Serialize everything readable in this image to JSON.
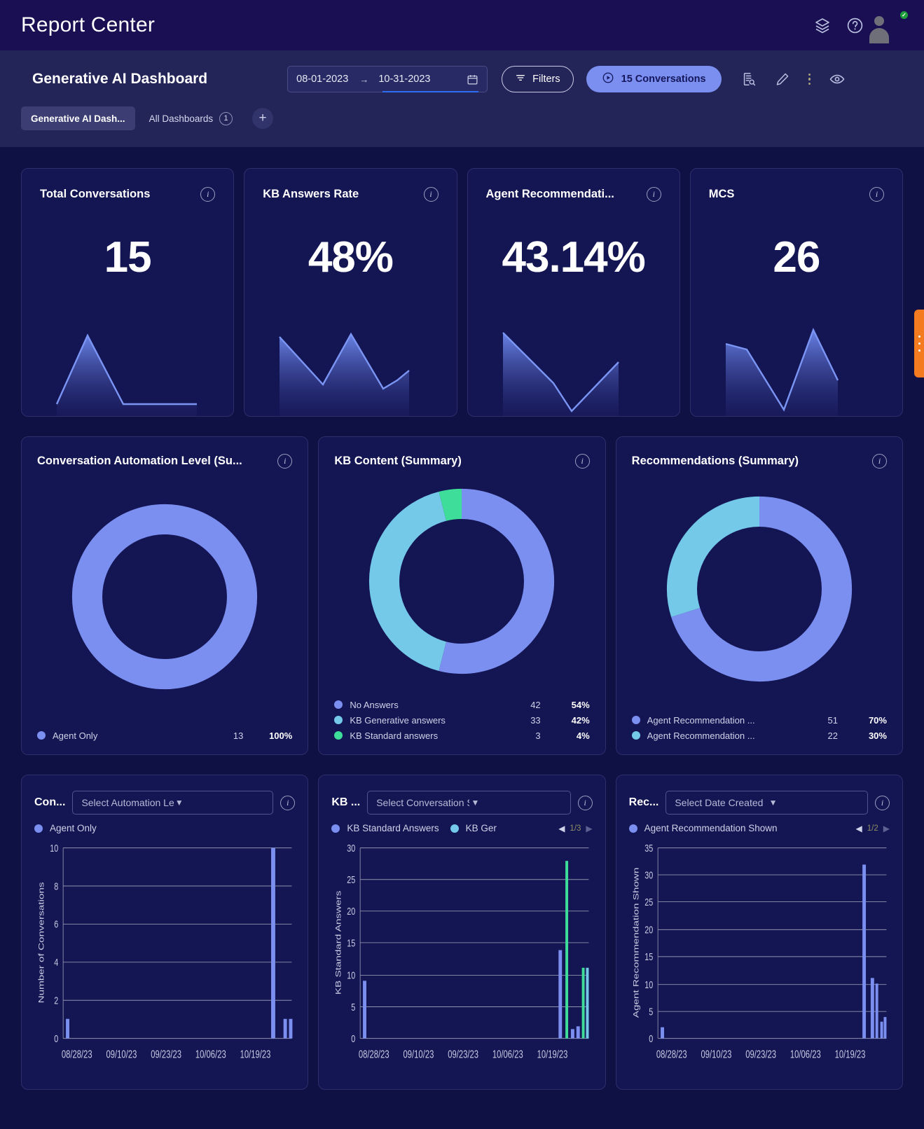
{
  "topbar": {
    "title": "Report Center",
    "icons": [
      "layers-icon",
      "help-icon",
      "avatar"
    ]
  },
  "dashboard_header": {
    "title": "Generative AI Dashboard",
    "date_from": "08-01-2023",
    "date_to": "10-31-2023",
    "range_arrow": "→",
    "filters_label": "Filters",
    "conversations_label": "15 Conversations",
    "accent_color": "#7b8ff0"
  },
  "tabs": [
    {
      "label": "Generative AI Dash...",
      "active": true,
      "count": ""
    },
    {
      "label": "All Dashboards",
      "active": false,
      "count": "1"
    }
  ],
  "tab_add_label": "+",
  "kpis": [
    {
      "title": "Total Conversations",
      "value": "15",
      "spark": "0,118 44,20 95,118 200,118 262,118"
    },
    {
      "title": "KB Answers Rate",
      "value": "48%",
      "spark": "0,24 65,92 105,21 160,98 185,82 200,68"
    },
    {
      "title": "Agent Recommendati...",
      "value": "43.14%",
      "spark": "0,18 70,84 125,122 200,62"
    },
    {
      "title": "MCS",
      "value": "26",
      "spark": "0,34 50,40 105,122 150,15 200,78"
    }
  ],
  "donuts": [
    {
      "title": "Conversation Automation Level (Su...",
      "chart_data": {
        "type": "pie",
        "title": "Conversation Automation Level (Summary)",
        "legend_position": "bottom",
        "labels": [
          "Agent Only"
        ],
        "values": [
          13
        ],
        "percents": [
          "100%"
        ],
        "colors": [
          "#7b8ff0"
        ]
      },
      "legend": [
        {
          "label": "Agent Only",
          "count": "13",
          "pct": "100%",
          "color": "#7b8ff0"
        }
      ]
    },
    {
      "title": "KB Content (Summary)",
      "chart_data": {
        "type": "pie",
        "title": "KB Content (Summary)",
        "legend_position": "bottom",
        "labels": [
          "No Answers",
          "KB Generative answers",
          "KB Standard answers"
        ],
        "values": [
          42,
          33,
          3
        ],
        "percents": [
          "54%",
          "42%",
          "4%"
        ],
        "colors": [
          "#7b8ff0",
          "#74c8e8",
          "#3edd9a"
        ]
      },
      "legend": [
        {
          "label": "No Answers",
          "count": "42",
          "pct": "54%",
          "color": "#7b8ff0"
        },
        {
          "label": "KB Generative answers",
          "count": "33",
          "pct": "42%",
          "color": "#74c8e8"
        },
        {
          "label": "KB Standard answers",
          "count": "3",
          "pct": "4%",
          "color": "#3edd9a"
        }
      ]
    },
    {
      "title": "Recommendations (Summary)",
      "chart_data": {
        "type": "pie",
        "title": "Recommendations (Summary)",
        "legend_position": "bottom",
        "labels": [
          "Agent Recommendation ...",
          "Agent Recommendation ..."
        ],
        "values": [
          51,
          22
        ],
        "percents": [
          "70%",
          "30%"
        ],
        "colors": [
          "#7b8ff0",
          "#74c8e8"
        ]
      },
      "legend": [
        {
          "label": "Agent Recommendation ...",
          "count": "51",
          "pct": "70%",
          "color": "#7b8ff0"
        },
        {
          "label": "Agent Recommendation ...",
          "count": "22",
          "pct": "30%",
          "color": "#74c8e8"
        }
      ]
    }
  ],
  "bar_panels": [
    {
      "title": "Con...",
      "select_value": "Select Automation Level",
      "legend": [
        {
          "label": "Agent Only",
          "color": "#7b8ff0"
        }
      ],
      "pager": null,
      "chart_data": {
        "type": "bar",
        "ylabel": "Number of Conversations",
        "xlabel": "",
        "ylim": [
          0,
          10
        ],
        "yticks": [
          0,
          2,
          4,
          6,
          8,
          10
        ],
        "xticks": [
          "08/28/23",
          "09/10/23",
          "09/23/23",
          "10/06/23",
          "10/19/23"
        ],
        "grid": true,
        "series": [
          {
            "name": "Agent Only",
            "color": "#7b8ff0",
            "points": [
              [
                0.04,
                1
              ],
              [
                0.945,
                10
              ],
              [
                0.975,
                1
              ],
              [
                0.995,
                1
              ]
            ]
          }
        ]
      }
    },
    {
      "title": "KB ...",
      "select_value": "Select Conversation Start Date",
      "legend": [
        {
          "label": "KB Standard Answers",
          "color": "#7b8ff0"
        },
        {
          "label": "KB Ger",
          "color": "#74c8e8"
        }
      ],
      "pager": {
        "page": "1/3",
        "prev": "◀",
        "next": "▶"
      },
      "chart_data": {
        "type": "bar",
        "ylabel": "KB Standard Answers",
        "xlabel": "",
        "ylim": [
          0,
          30
        ],
        "yticks": [
          0,
          5,
          10,
          15,
          20,
          25,
          30
        ],
        "xticks": [
          "08/28/23",
          "09/10/23",
          "09/23/23",
          "10/06/23",
          "10/19/23"
        ],
        "grid": true,
        "series": [
          {
            "name": "KB Standard Answers",
            "color": "#7b8ff0",
            "points": [
              [
                0.04,
                9
              ],
              [
                0.905,
                14
              ],
              [
                0.935,
                1.5
              ],
              [
                0.955,
                2
              ],
              [
                0.985,
                11
              ]
            ]
          },
          {
            "name": "KB Generative Answers",
            "color": "#3edd9a",
            "points": [
              [
                0.925,
                28
              ],
              [
                0.975,
                11
              ]
            ]
          }
        ]
      }
    },
    {
      "title": "Rec...",
      "select_value": "Select Date Created",
      "legend": [
        {
          "label": "Agent Recommendation Shown",
          "color": "#7b8ff0"
        }
      ],
      "pager": {
        "page": "1/2",
        "prev": "◀",
        "next": "▶"
      },
      "chart_data": {
        "type": "bar",
        "ylabel": "Agent Recommendation Shown",
        "xlabel": "",
        "ylim": [
          0,
          35
        ],
        "yticks": [
          0,
          5,
          10,
          15,
          20,
          25,
          30,
          35
        ],
        "xticks": [
          "08/28/23",
          "09/10/23",
          "09/23/23",
          "10/06/23",
          "10/19/23"
        ],
        "grid": true,
        "series": [
          {
            "name": "Agent Recommendation Shown",
            "color": "#7b8ff0",
            "points": [
              [
                0.04,
                2
              ],
              [
                0.9,
                32
              ],
              [
                0.935,
                11
              ],
              [
                0.955,
                10
              ],
              [
                0.975,
                3
              ],
              [
                0.99,
                4
              ]
            ]
          }
        ]
      }
    }
  ]
}
